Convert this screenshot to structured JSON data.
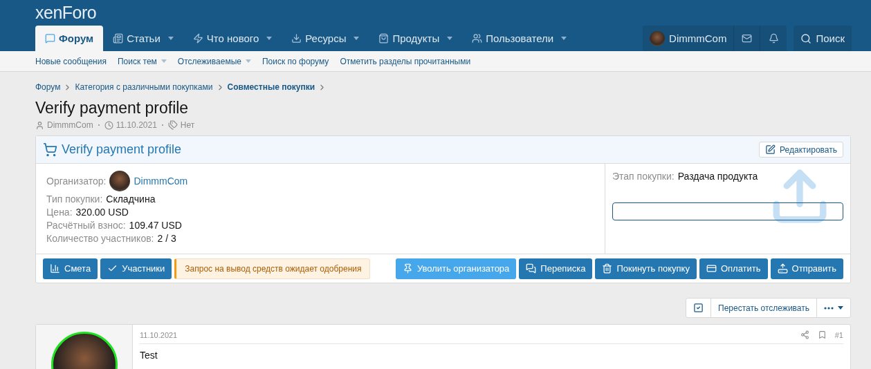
{
  "logo": "xenForo",
  "nav": {
    "tabs": [
      {
        "label": "Форум",
        "selected": true,
        "has_menu": false
      },
      {
        "label": "Статьи",
        "selected": false,
        "has_menu": true
      },
      {
        "label": "Что нового",
        "selected": false,
        "has_menu": true
      },
      {
        "label": "Ресурсы",
        "selected": false,
        "has_menu": true
      },
      {
        "label": "Продукты",
        "selected": false,
        "has_menu": true
      },
      {
        "label": "Пользователи",
        "selected": false,
        "has_menu": true
      }
    ],
    "user": "DimmmCom",
    "search": "Поиск"
  },
  "subnav": [
    {
      "label": "Новые сообщения",
      "has_menu": false
    },
    {
      "label": "Поиск тем",
      "has_menu": true
    },
    {
      "label": "Отслеживаемые",
      "has_menu": true
    },
    {
      "label": "Поиск по форуму",
      "has_menu": false
    },
    {
      "label": "Отметить разделы прочитанными",
      "has_menu": false
    }
  ],
  "breadcrumb": [
    {
      "label": "Форум",
      "current": false
    },
    {
      "label": "Категория с различными покупками",
      "current": false
    },
    {
      "label": "Совместные покупки",
      "current": true
    }
  ],
  "title": "Verify payment profile",
  "meta": {
    "author": "DimmmCom",
    "date": "11.10.2021",
    "tags": "Нет"
  },
  "card": {
    "title": "Verify payment profile",
    "edit": "Редактировать",
    "organizer_label": "Организатор:",
    "organizer": "DimmmCom",
    "fields": [
      {
        "label": "Тип покупки:",
        "value": "Складчина"
      },
      {
        "label": "Цена:",
        "value": "320.00 USD"
      },
      {
        "label": "Расчётный взнос:",
        "value": "109.47 USD"
      },
      {
        "label": "Количество участников:",
        "value": "2 / 3"
      }
    ],
    "stage_label": "Этап покупки:",
    "stage": "Раздача продукта",
    "left_actions": [
      {
        "kind": "button",
        "label": "Смета"
      },
      {
        "kind": "button",
        "label": "Участники"
      },
      {
        "kind": "notice",
        "label": "Запрос на вывод средств ожидает одобрения"
      }
    ],
    "right_actions": [
      {
        "kind": "highlight",
        "label": "Уволить организатора"
      },
      {
        "kind": "button",
        "label": "Переписка"
      },
      {
        "kind": "button",
        "label": "Покинуть покупку"
      },
      {
        "kind": "button",
        "label": "Оплатить"
      },
      {
        "kind": "button",
        "label": "Отправить"
      }
    ]
  },
  "watch": {
    "checked": true,
    "label": "Перестать отслеживать"
  },
  "post": {
    "date": "11.10.2021",
    "number": "#1",
    "text": "Test"
  }
}
